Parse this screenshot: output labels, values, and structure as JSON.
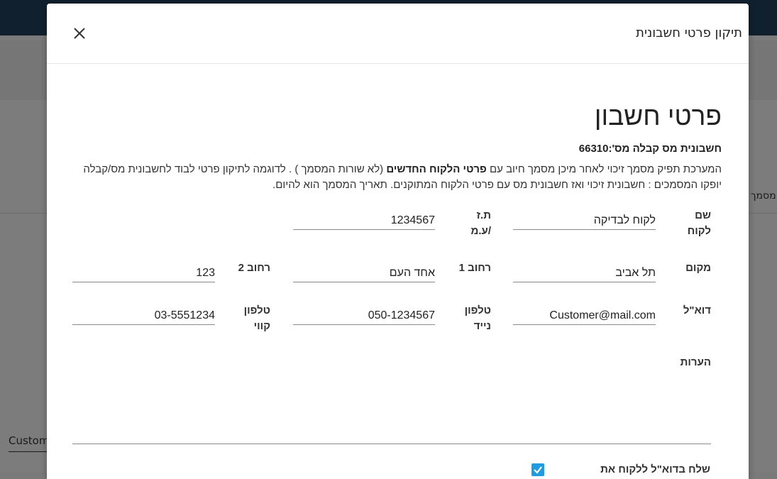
{
  "background": {
    "right_text": "מסמך",
    "left_input_value": "Customer"
  },
  "modal": {
    "title": "תיקון פרטי חשבונית",
    "section_title": "פרטי חשבון",
    "invoice_line": "חשבונית מס קבלה מס':66310",
    "description": {
      "part1": "המערכת תפיק מסמך זיכוי לאחר מיכן מסמך חיוב עם ",
      "bold": "פרטי הלקוח החדשים",
      "part2": " (לא שורות המסמך ) . לדוגמה לתיקון פרטי לבוד לחשבונית מס/קבלה יופקו המסמכים : חשבונית זיכוי ואז חשבונית מס עם פרטי הלקוח המתוקנים. תאריך המסמך הוא להיום."
    },
    "fields": {
      "customer_name": {
        "label": "שם לקוח",
        "value": "לקוח לבדיקה"
      },
      "id_number": {
        "label": "ת.ז /ע.מ",
        "value": "1234567"
      },
      "city": {
        "label": "מקום",
        "value": "תל אביב"
      },
      "street1": {
        "label": "רחוב 1",
        "value": "אחד העם"
      },
      "street2": {
        "label": "רחוב 2",
        "value": "123"
      },
      "email": {
        "label": "דוא\"ל",
        "value": "Customer@mail.com"
      },
      "mobile": {
        "label": "טלפון נייד",
        "value": "050-1234567"
      },
      "landline": {
        "label": "טלפון קווי",
        "value": "03-5551234"
      },
      "notes": {
        "label": "הערות",
        "value": ""
      }
    },
    "send_email_label": "שלח בדוא\"ל ללקוח את",
    "send_email_checked": true
  },
  "colors": {
    "accent": "#1f9be0",
    "topbar": "#11202e"
  }
}
